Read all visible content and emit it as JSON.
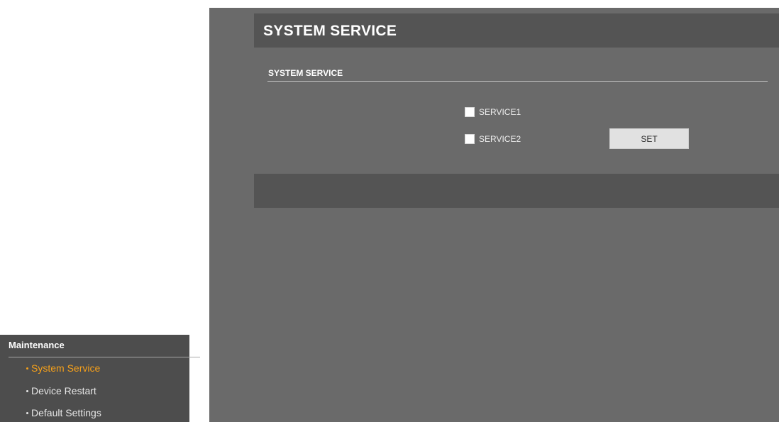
{
  "sidebar": {
    "section_title": "Maintenance",
    "items": [
      {
        "label": "System Service",
        "active": true
      },
      {
        "label": "Device Restart",
        "active": false
      },
      {
        "label": "Default Settings",
        "active": false
      }
    ]
  },
  "main": {
    "title": "SYSTEM SERVICE",
    "section_label": "SYSTEM SERVICE",
    "services": [
      {
        "label": "SERVICE1",
        "checked": false
      },
      {
        "label": "SERVICE2",
        "checked": false
      }
    ],
    "set_label": "SET"
  },
  "colors": {
    "accent": "#f5a01a",
    "content_bg": "#6a6a6a",
    "bar_bg": "#545454",
    "menu_bg": "#4d4d4d"
  }
}
